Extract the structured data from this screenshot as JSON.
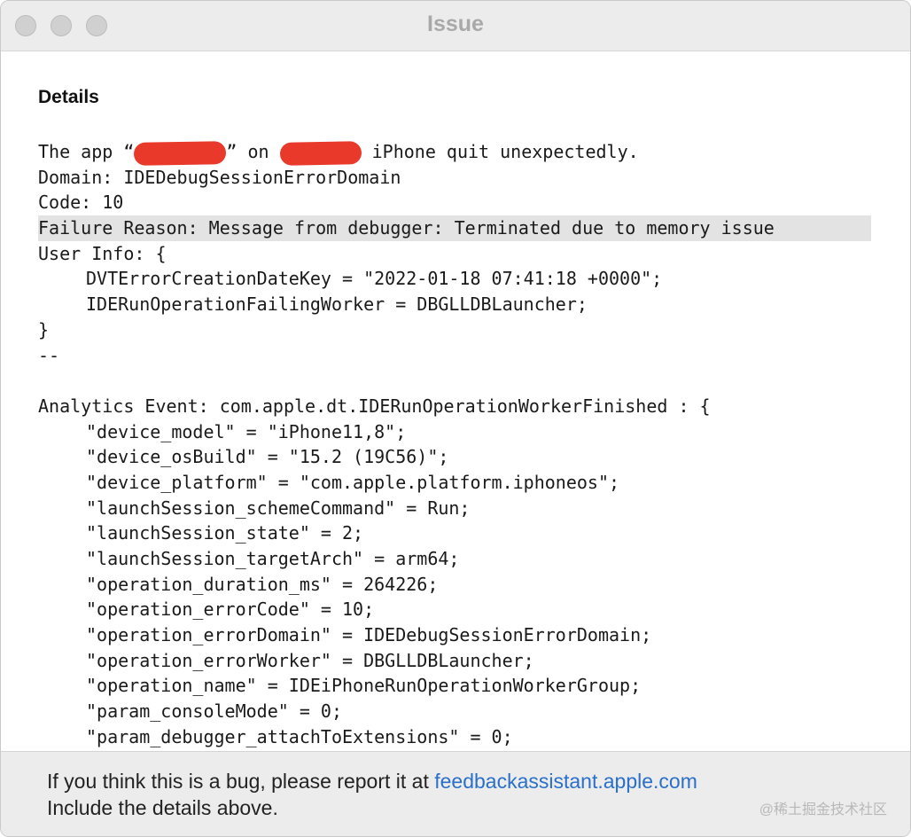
{
  "window": {
    "title": "Issue"
  },
  "details": {
    "heading": "Details",
    "intro": {
      "prefix": "The app “",
      "mid": "” on ",
      "suffix": " iPhone quit unexpectedly."
    },
    "domain_line": "Domain: IDEDebugSessionErrorDomain",
    "code_line": "Code: 10",
    "failure_line": "Failure Reason: Message from debugger: Terminated due to memory issue",
    "user_info_open": "User Info: {",
    "user_info_items": [
      "DVTErrorCreationDateKey = \"2022-01-18 07:41:18 +0000\";",
      "IDERunOperationFailingWorker = DBGLLDBLauncher;"
    ],
    "user_info_close": "}",
    "separator": "--",
    "analytics_open": "Analytics Event: com.apple.dt.IDERunOperationWorkerFinished : {",
    "analytics_items": [
      "\"device_model\" = \"iPhone11,8\";",
      "\"device_osBuild\" = \"15.2 (19C56)\";",
      "\"device_platform\" = \"com.apple.platform.iphoneos\";",
      "\"launchSession_schemeCommand\" = Run;",
      "\"launchSession_state\" = 2;",
      "\"launchSession_targetArch\" = arm64;",
      "\"operation_duration_ms\" = 264226;",
      "\"operation_errorCode\" = 10;",
      "\"operation_errorDomain\" = IDEDebugSessionErrorDomain;",
      "\"operation_errorWorker\" = DBGLLDBLauncher;",
      "\"operation_name\" = IDEiPhoneRunOperationWorkerGroup;",
      "\"param_consoleMode\" = 0;",
      "\"param_debugger_attachToExtensions\" = 0;"
    ]
  },
  "footer": {
    "line1_prefix": "If you think this is a bug, please report it at ",
    "link": "feedbackassistant.apple.com",
    "line2": "Include the details above.",
    "watermark": "@稀土掘金技术社区"
  },
  "colors": {
    "redaction": "#e8392a",
    "link": "#2a6fc9",
    "highlight": "#e3e3e3"
  }
}
